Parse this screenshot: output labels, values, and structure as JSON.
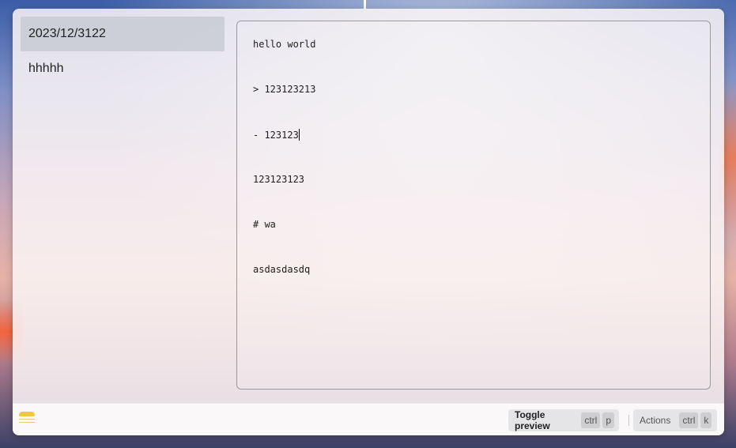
{
  "sidebar": {
    "items": [
      {
        "label": "2023/12/3122",
        "active": true
      },
      {
        "label": "hhhhh",
        "active": false
      }
    ]
  },
  "editor": {
    "lines": [
      "hello world",
      "> 123123213",
      "- 123123",
      "123123123",
      "# wa",
      "asdasdasdq"
    ]
  },
  "footer": {
    "app_icon": "notes-icon",
    "toggle_preview": {
      "label": "Toggle preview",
      "keys": [
        "ctrl",
        "p"
      ]
    },
    "actions": {
      "label": "Actions",
      "keys": [
        "ctrl",
        "k"
      ]
    }
  },
  "colors": {
    "accent_yellow": "#f2c744",
    "active_item_bg": "#c8cbd4"
  }
}
